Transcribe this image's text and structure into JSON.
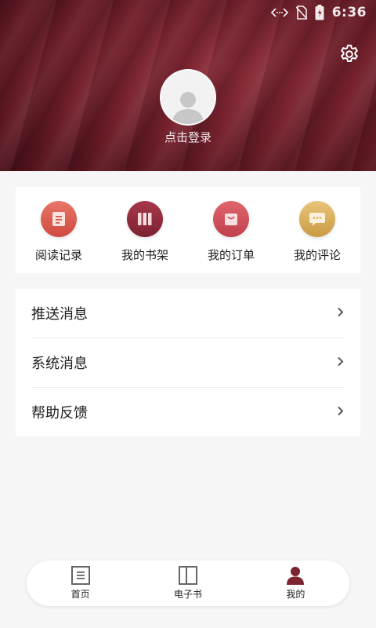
{
  "status_bar": {
    "time": "6:36",
    "icons": [
      "code-arrows-icon",
      "no-sim-icon",
      "battery-icon"
    ]
  },
  "header": {
    "login_label": "点击登录",
    "settings_icon": "gear-icon",
    "avatar_icon": "user-silhouette-icon"
  },
  "quick_actions": [
    {
      "label": "阅读记录",
      "icon": "document-icon",
      "color": "#d65a4c"
    },
    {
      "label": "我的书架",
      "icon": "bookshelf-icon",
      "color": "#8f2a3c"
    },
    {
      "label": "我的订单",
      "icon": "shopping-bag-icon",
      "color": "#cf4f5a"
    },
    {
      "label": "我的评论",
      "icon": "chat-bubble-icon",
      "color": "#d8ab58"
    }
  ],
  "menu": [
    {
      "label": "推送消息"
    },
    {
      "label": "系统消息"
    },
    {
      "label": "帮助反馈"
    }
  ],
  "bottom_nav": {
    "items": [
      {
        "label": "首页",
        "icon": "home-doc-icon",
        "active": false
      },
      {
        "label": "电子书",
        "icon": "open-book-icon",
        "active": false
      },
      {
        "label": "我的",
        "icon": "profile-icon",
        "active": true
      }
    ],
    "active_color": "#7e2430"
  }
}
